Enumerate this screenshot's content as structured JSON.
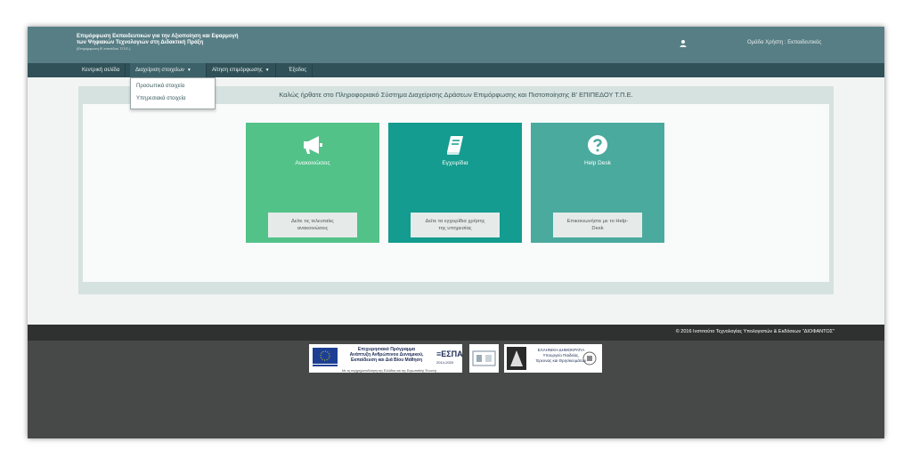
{
  "header": {
    "title_line1": "Επιμόρφωση Εκπαιδευτικών για την Αξιοποίηση και Εφαρμογή",
    "title_line2": "των Ψηφιακών Τεχνολογιών στη Διδακτική Πράξη",
    "title_line3": "(Επιμόρφωση Β' επιπέδου Τ.Π.Ε.)",
    "user_icon": "user-icon",
    "user_role": "Ομάδα Χρήστη : Εκπαιδευτικός"
  },
  "nav": {
    "items": [
      {
        "label": "Κεντρική σελίδα"
      },
      {
        "label": "Διαχείριση στοιχείων"
      },
      {
        "label": "Αίτηση επιμόρφωσης"
      },
      {
        "label": "Έξοδος"
      }
    ],
    "dropdown": [
      {
        "label": "Προσωπικά στοιχεία"
      },
      {
        "label": "Υπηρεσιακά στοιχεία"
      }
    ]
  },
  "main": {
    "welcome": "Καλώς ήρθατε στο Πληροφοριακό Σύστημα Διαχείρισης Δράσεων Επιμόρφωσης και Πιστοποίησης Β' ΕΠΙΠΕΔΟΥ Τ.Π.Ε.",
    "cards": [
      {
        "title": "Ανακοινώσεις",
        "icon": "megaphone-icon",
        "button_line1": "Δείτε τις τελευταίες",
        "button_line2": "ανακοινώσεις",
        "color": "#52c289"
      },
      {
        "title": "Εγχειρίδια",
        "icon": "book-icon",
        "button_line1": "Δείτε τα εγχειρίδια χρήσης",
        "button_line2": "της υπηρεσίας",
        "color": "#139c8f"
      },
      {
        "title": "Help Desk",
        "icon": "question-circle-icon",
        "button_line1": "Επικοινωνήστε με το Help-",
        "button_line2": "Desk",
        "color": "#4aaa9e"
      }
    ]
  },
  "footer": {
    "copyright": "© 2016 Ινστιτούτο Τεχνολογίας Υπολογιστών & Εκδόσεων \"ΔΙΟΦΑΝΤΟΣ\"",
    "espa_program_line1": "Επιχειρησιακό Πρόγραμμα",
    "espa_program_line2": "Ανάπτυξη Ανθρώπινου Δυναμικού,",
    "espa_program_line3": "Εκπαίδευση και Διά Βίου Μάθηση",
    "espa_small": "Με τη συγχρηματοδότηση της Ελλάδας και της Ευρωπαϊκής Ένωσης",
    "espa_mark": "≡ΕΣΠΑ",
    "espa_years": "2014-2020",
    "ministry_line1": "ΕΛΛΗΝΙΚΗ ΔΗΜΟΚΡΑΤΙΑ",
    "ministry_line2": "Υπουργείο Παιδείας,",
    "ministry_line3": "Έρευνας και Θρησκευμάτων"
  }
}
